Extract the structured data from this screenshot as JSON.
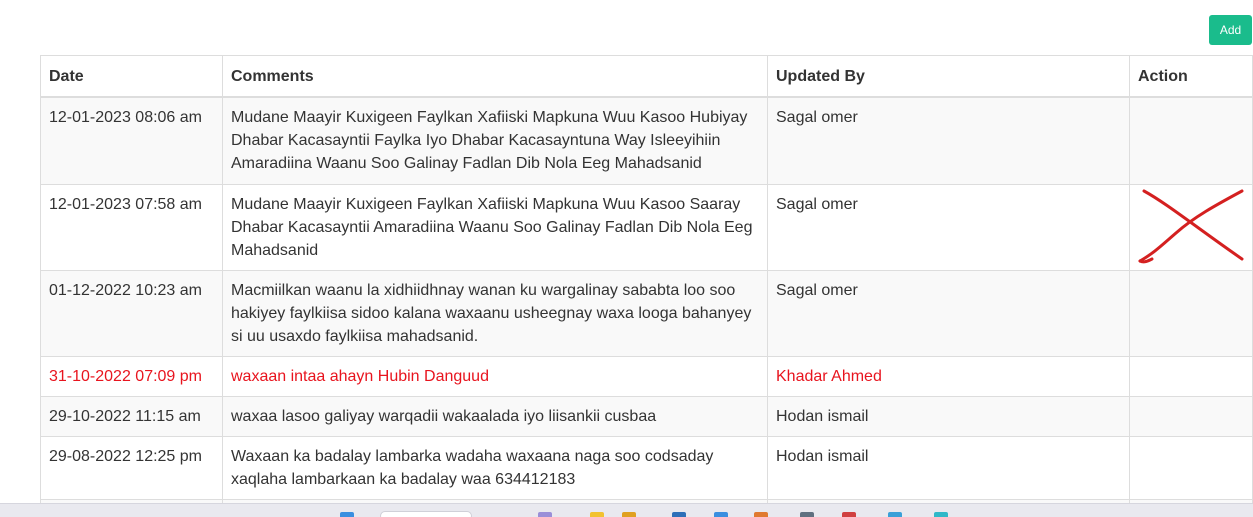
{
  "toolbar": {
    "add_label": "Add"
  },
  "table": {
    "headers": {
      "date": "Date",
      "comments": "Comments",
      "updated_by": "Updated By",
      "action": "Action"
    },
    "rows": [
      {
        "date": "12-01-2023 08:06 am",
        "comment": "Mudane Maayir Kuxigeen Faylkan Xafiiski Mapkuna Wuu Kasoo Hubiyay Dhabar Kacasayntii Faylka Iyo Dhabar Kacasayntuna Way Isleeyihiin Amaradiina Waanu Soo Galinay Fadlan Dib Nola Eeg Mahadsanid",
        "updated_by": "Sagal omer"
      },
      {
        "date": "12-01-2023 07:58 am",
        "comment": "Mudane Maayir Kuxigeen Faylkan Xafiiski Mapkuna Wuu Kasoo Saaray Dhabar Kacasayntii Amaradiina Waanu Soo Galinay Fadlan Dib Nola Eeg Mahadsanid",
        "updated_by": "Sagal omer"
      },
      {
        "date": "01-12-2022 10:23 am",
        "comment": "Macmiilkan waanu la xidhiidhnay wanan ku wargalinay sababta loo soo hakiyey faylkiisa sidoo kalana waxaanu usheegnay waxa looga bahanyey si uu usaxdo faylkiisa mahadsanid.",
        "updated_by": "Sagal omer"
      },
      {
        "date": "31-10-2022 07:09 pm",
        "comment": "waxaan intaa ahayn Hubin Danguud",
        "updated_by": "Khadar Ahmed"
      },
      {
        "date": "29-10-2022 11:15 am",
        "comment": "waxaa lasoo galiyay warqadii wakaalada iyo liisankii cusbaa",
        "updated_by": "Hodan ismail"
      },
      {
        "date": "29-08-2022 12:25 pm",
        "comment": "Waxaan ka badalay lambarka wadaha waxaana naga soo codsaday xaqlaha lambarkaan ka badalay waa 634412183",
        "updated_by": "Hodan ismail"
      }
    ]
  },
  "colors": {
    "accent": "#1abc8c",
    "highlight_text": "#e8141e",
    "annotation": "#d42020"
  },
  "annotation_icon": "hand-drawn-x-icon"
}
